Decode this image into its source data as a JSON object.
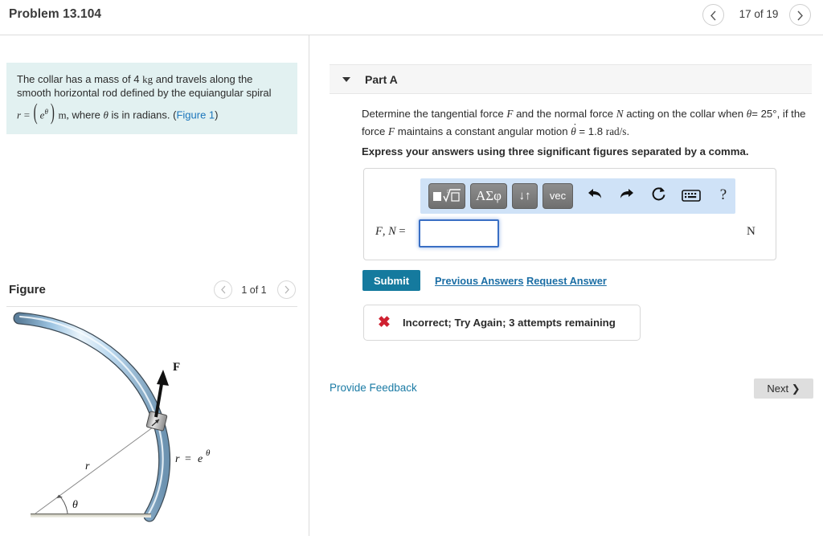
{
  "header": {
    "problem_title": "Problem 13.104",
    "page_counter": "17 of 19",
    "prev_icon": "chevron-left-icon",
    "next_icon": "chevron-right-icon"
  },
  "statement": {
    "line1": "The collar has a mass of 4",
    "unit_mass": "kg",
    "line1_cont": "and travels along the",
    "line2": "smooth horizontal rod defined by the equiangular spiral",
    "eq_r": "r",
    "eq_equals": "=",
    "eq_base": "e",
    "eq_exp": "θ",
    "eq_unit": "m,",
    "eq_tail_pre": "where",
    "eq_theta": "θ",
    "eq_tail_post": "is in radians. (",
    "figure_link": "Figure 1",
    "eq_tail_end": ")"
  },
  "figure": {
    "label": "Figure",
    "counter": "1 of 1",
    "prev_icon": "chevron-left-icon",
    "next_icon": "chevron-right-icon",
    "annotations": {
      "force": "F",
      "radius": "r",
      "angle": "θ",
      "curve_eq_lhs": "r",
      "curve_eq_eq": "=",
      "curve_eq_base": "e",
      "curve_eq_exp": "θ"
    },
    "colors": {
      "rod_light": "#cfe4f5",
      "rod_mid": "#8dbbdd",
      "rod_outline": "#3c4a55",
      "ground": "#b9b7a8"
    }
  },
  "part_a": {
    "label": "Part A",
    "caret_icon": "caret-down-icon",
    "question": {
      "t1": "Determine the tangential force",
      "sym_F": "F",
      "t2": "and the normal force",
      "sym_N": "N",
      "t3": "acting on the collar when",
      "sym_theta": "θ",
      "t4": "= 25",
      "deg": "°",
      "t5": ", if",
      "t6": "the force",
      "sym_F2": "F",
      "t7": "maintains a constant angular motion",
      "sym_thetadot": "θ",
      "t8": "= 1.8",
      "unit_rad": "rad/s",
      "t9": "."
    },
    "express_instruction": "Express your answers using three significant figures separated by a comma.",
    "toolbar": {
      "template_button": "template-button",
      "greek_button": "ΑΣφ",
      "arrows_button": "↓↑",
      "vec_button": "vec",
      "undo_icon": "undo-arrow-icon",
      "redo_icon": "redo-arrow-icon",
      "reset_icon": "reset-circular-arrow-icon",
      "keyboard_icon": "keyboard-icon",
      "help_icon": "question-mark-icon",
      "help_label": "?"
    },
    "answer": {
      "label_F": "F",
      "label_comma": ",",
      "label_N": "N",
      "label_equals": "=",
      "value": "",
      "placeholder": "",
      "unit": "N"
    },
    "submit_label": "Submit",
    "previous_answers_label": "Previous Answers",
    "request_answer_label": "Request Answer",
    "feedback": {
      "icon": "red-x-icon",
      "icon_glyph": "✖",
      "message": "Incorrect; Try Again; 3 attempts remaining",
      "color": "#cf2030"
    }
  },
  "footer": {
    "provide_feedback_label": "Provide Feedback",
    "next_label": "Next",
    "next_icon": "chevron-right-icon"
  }
}
